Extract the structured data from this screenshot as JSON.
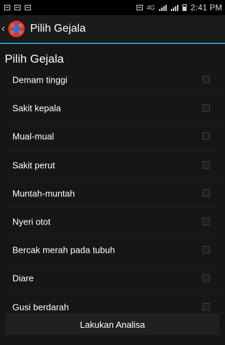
{
  "status_bar": {
    "time": "2:41 PM",
    "left_icons": [
      "notification-box-icon",
      "chat-icon",
      "image-icon"
    ],
    "right_icons": [
      "sim-icon",
      "network-4g-icon",
      "signal-icon",
      "wifi-signal-icon",
      "battery-icon"
    ],
    "network_text": "4G"
  },
  "action_bar": {
    "title": "Pilih Gejala",
    "back_glyph": "‹",
    "app_icon": "app-logo-icon"
  },
  "content": {
    "heading": "Pilih Gejala",
    "symptoms": [
      {
        "label": "Demam tinggi",
        "checked": false
      },
      {
        "label": "Sakit kepala",
        "checked": false
      },
      {
        "label": "Mual-mual",
        "checked": false
      },
      {
        "label": "Sakit perut",
        "checked": false
      },
      {
        "label": "Muntah-muntah",
        "checked": false
      },
      {
        "label": "Nyeri otot",
        "checked": false
      },
      {
        "label": "Bercak merah pada tubuh",
        "checked": false
      },
      {
        "label": "Diare",
        "checked": false
      },
      {
        "label": "Gusi berdarah",
        "checked": false
      }
    ],
    "analyze_button": "Lakukan Analisa"
  },
  "colors": {
    "accent": "#2f98bb",
    "background": "#161616",
    "status_bar": "#000000"
  }
}
